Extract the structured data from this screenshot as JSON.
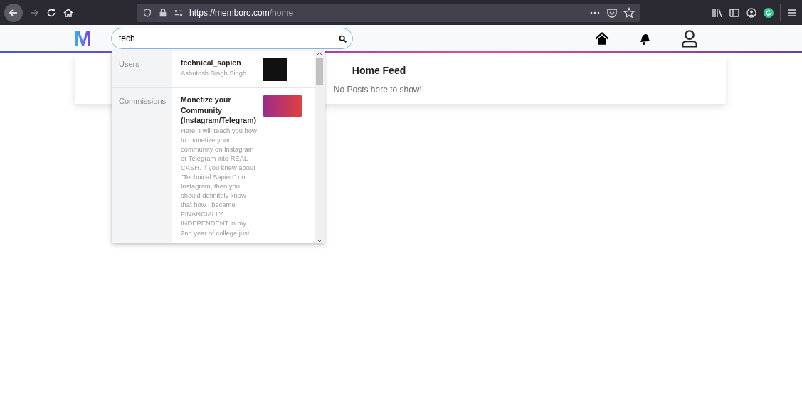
{
  "browser": {
    "url_host": "https://memboro.com",
    "url_path": "/home"
  },
  "navbar": {
    "logo": "M",
    "search": {
      "value": "tech"
    }
  },
  "feed": {
    "title": "Home Feed",
    "empty_message": "No Posts here to show!!"
  },
  "search_results": [
    {
      "kind": "user",
      "section": "Users",
      "title": "technical_sapien",
      "subtitle": "Ashutosh Singh Singh"
    },
    {
      "kind": "commission",
      "section": "Commissions",
      "title": "Monetize your Community (Instagram/Telegram)",
      "description": "Here, I will teach you how to monetize your community on Instagram or Telegram into REAL CASH. If you knew about \"Technical Sapien\" on Instagram, then you should definitely know that how I became FINANCIALLY INDEPENDENT in my 2nd year of college just"
    }
  ]
}
